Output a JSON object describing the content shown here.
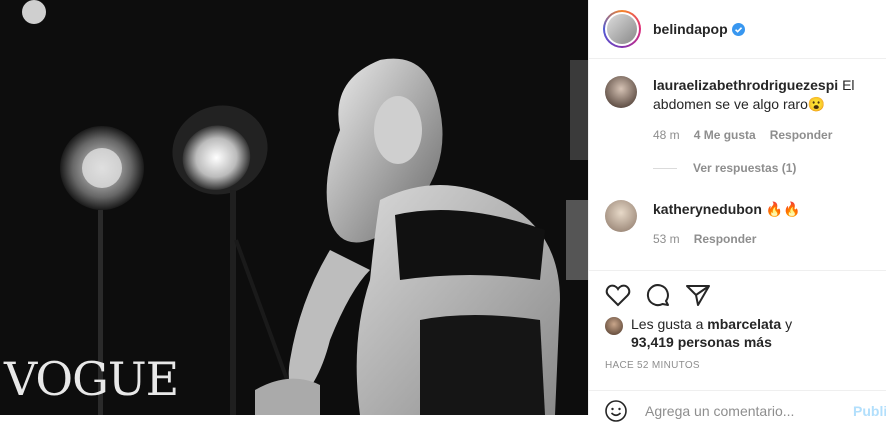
{
  "post": {
    "image_watermark": "VOGUE",
    "username": "belindapop"
  },
  "comments": [
    {
      "username": "lauraelizabethrodriguezespi",
      "text": "El abdomen se ve algo raro😮",
      "time": "48 m",
      "likes": "4 Me gusta",
      "reply": "Responder"
    },
    {
      "username": "katherynedubon",
      "text": "🔥🔥",
      "time": "53 m",
      "reply": "Responder"
    }
  ],
  "view_replies": "Ver respuestas (1)",
  "likes": {
    "prefix": "Les gusta a",
    "user": "mbarcelata",
    "suffix": "y",
    "count": "93,419 personas más"
  },
  "timestamp": "HACE 52 MINUTOS",
  "add_comment": {
    "placeholder": "Agrega un comentario...",
    "publish": "Publi"
  },
  "icons": [
    "heart-icon",
    "comment-icon",
    "share-icon",
    "emoji-icon",
    "verified-icon"
  ],
  "colors": {
    "verified": "#3897f0",
    "publish": "#b2dffc",
    "muted": "#8e8e8e"
  }
}
